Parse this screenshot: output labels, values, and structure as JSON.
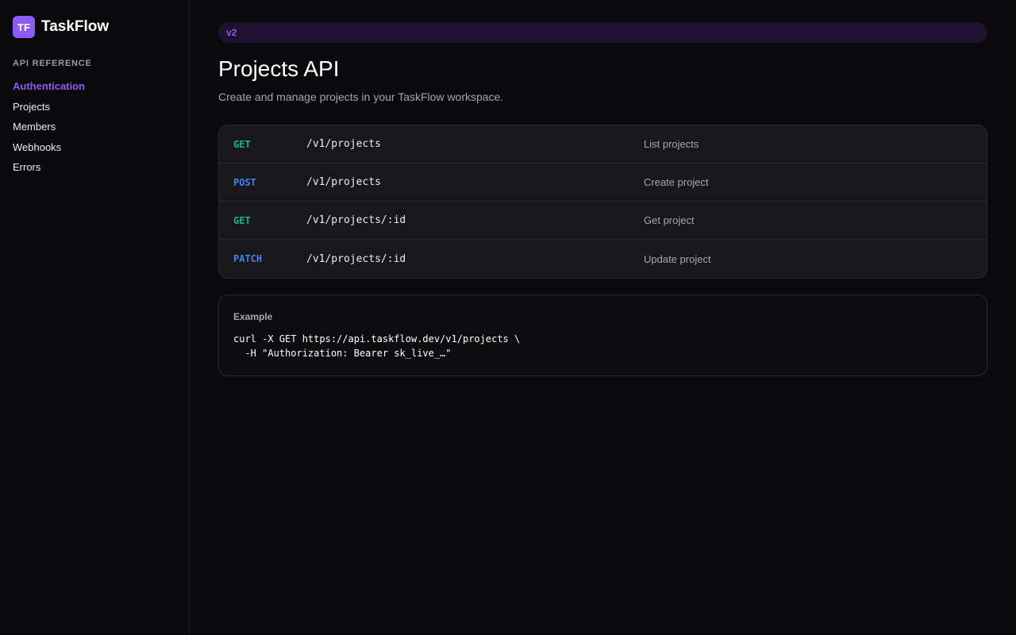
{
  "brand": {
    "logo_text": "TF",
    "name": "TaskFlow",
    "accent_color": "#8b5cf6"
  },
  "sidebar": {
    "section_label": "API REFERENCE",
    "items": [
      {
        "label": "Authentication",
        "active": true
      },
      {
        "label": "Projects",
        "active": false
      },
      {
        "label": "Members",
        "active": false
      },
      {
        "label": "Webhooks",
        "active": false
      },
      {
        "label": "Errors",
        "active": false
      }
    ]
  },
  "main": {
    "version": "v2",
    "title": "Projects API",
    "subtitle": "Create and manage projects in your TaskFlow workspace.",
    "endpoints": [
      {
        "method": "GET",
        "path": "/v1/projects",
        "description": "List projects"
      },
      {
        "method": "POST",
        "path": "/v1/projects",
        "description": "Create project"
      },
      {
        "method": "GET",
        "path": "/v1/projects/:id",
        "description": "Get project"
      },
      {
        "method": "PATCH",
        "path": "/v1/projects/:id",
        "description": "Update project"
      }
    ],
    "example": {
      "label": "Example",
      "code": "curl -X GET https://api.taskflow.dev/v1/projects \\\n  -H \"Authorization: Bearer sk_live_…\""
    }
  },
  "colors": {
    "get_method": "#10b981",
    "write_method": "#3b82f6",
    "background": "#0a0a0c",
    "card": "#18181b"
  }
}
